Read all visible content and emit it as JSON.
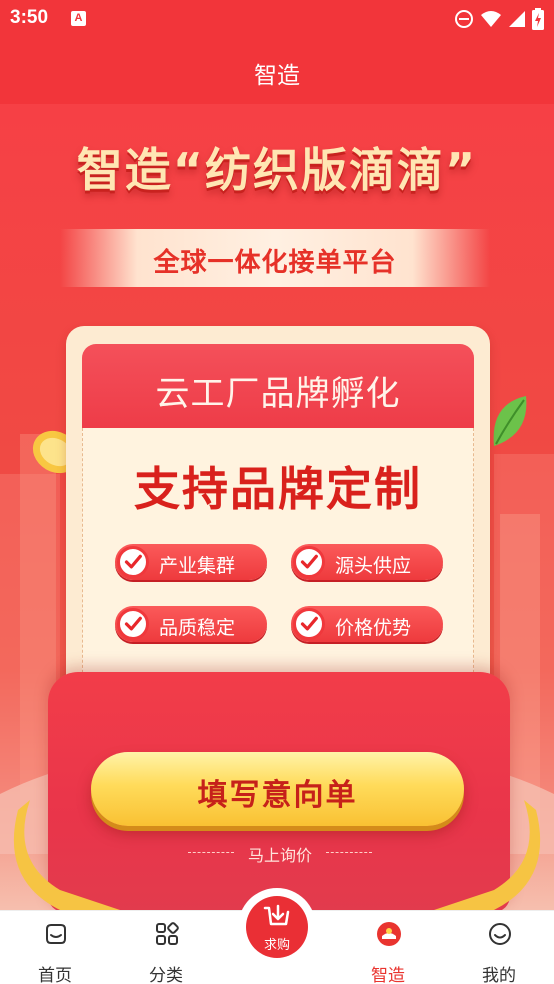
{
  "status_bar": {
    "time": "3:50",
    "app_icon_letter": "A",
    "icons": [
      "dnd-icon",
      "wifi-icon",
      "signal-icon",
      "battery-charging-icon"
    ]
  },
  "title_bar": {
    "title": "智造"
  },
  "banner": {
    "headline": "智造“纺织版滴滴”",
    "subheadline": "全球一体化接单平台",
    "card": {
      "header": "云工厂品牌孵化",
      "main": "支持品牌定制",
      "features": [
        "产业集群",
        "源头供应",
        "品质稳定",
        "价格优势"
      ]
    },
    "cta": {
      "button_label": "填写意向单",
      "sub_label": "马上询价"
    }
  },
  "bottom_nav": {
    "items": [
      {
        "label": "首页",
        "icon": "home-icon",
        "active": false
      },
      {
        "label": "分类",
        "icon": "category-icon",
        "active": false
      },
      {
        "label": "智造",
        "icon": "smart-manufacture-icon",
        "active": true
      },
      {
        "label": "我的",
        "icon": "profile-icon",
        "active": false
      }
    ],
    "center_button": {
      "label": "求购",
      "icon": "purchase-icon"
    }
  },
  "colors": {
    "brand_red": "#f2353a",
    "active_nav": "#e9342f",
    "cta_yellow": "#ffdb5a"
  }
}
